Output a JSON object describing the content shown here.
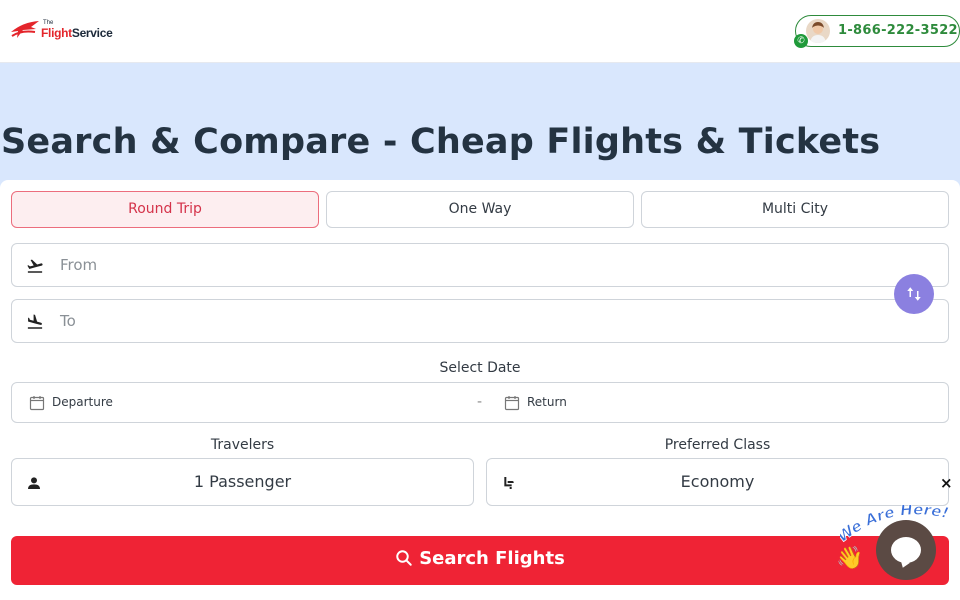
{
  "header": {
    "logo_the": "The",
    "logo_flight": "Flight",
    "logo_service": "Service",
    "phone_number": "1-866-222-3522"
  },
  "hero": {
    "title": "Search & Compare - Cheap Flights & Tickets"
  },
  "trip_tabs": [
    {
      "label": "Round Trip",
      "active": true
    },
    {
      "label": "One Way",
      "active": false
    },
    {
      "label": "Multi City",
      "active": false
    }
  ],
  "from_field": {
    "placeholder": "From",
    "icon": "takeoff-icon"
  },
  "to_field": {
    "placeholder": "To",
    "icon": "landing-icon"
  },
  "swap_icon": "swap-vertical-icon",
  "date": {
    "label": "Select Date",
    "departure": "Departure",
    "separator": "-",
    "return": "Return"
  },
  "travelers": {
    "label": "Travelers",
    "value": "1 Passenger",
    "icon": "person-icon"
  },
  "preferred_class": {
    "label": "Preferred Class",
    "value": "Economy",
    "icon": "seat-icon"
  },
  "close_label": "×",
  "search_button": {
    "label": "Search Flights",
    "icon": "search-icon"
  },
  "chat_widget": {
    "tagline": "We Are Here!",
    "icon": "chat-icon"
  },
  "colors": {
    "brand_red": "#ef2335",
    "hero_bg": "#d9e7fd",
    "swap_purple": "#8b80e0",
    "phone_green": "#2e8b3c"
  }
}
